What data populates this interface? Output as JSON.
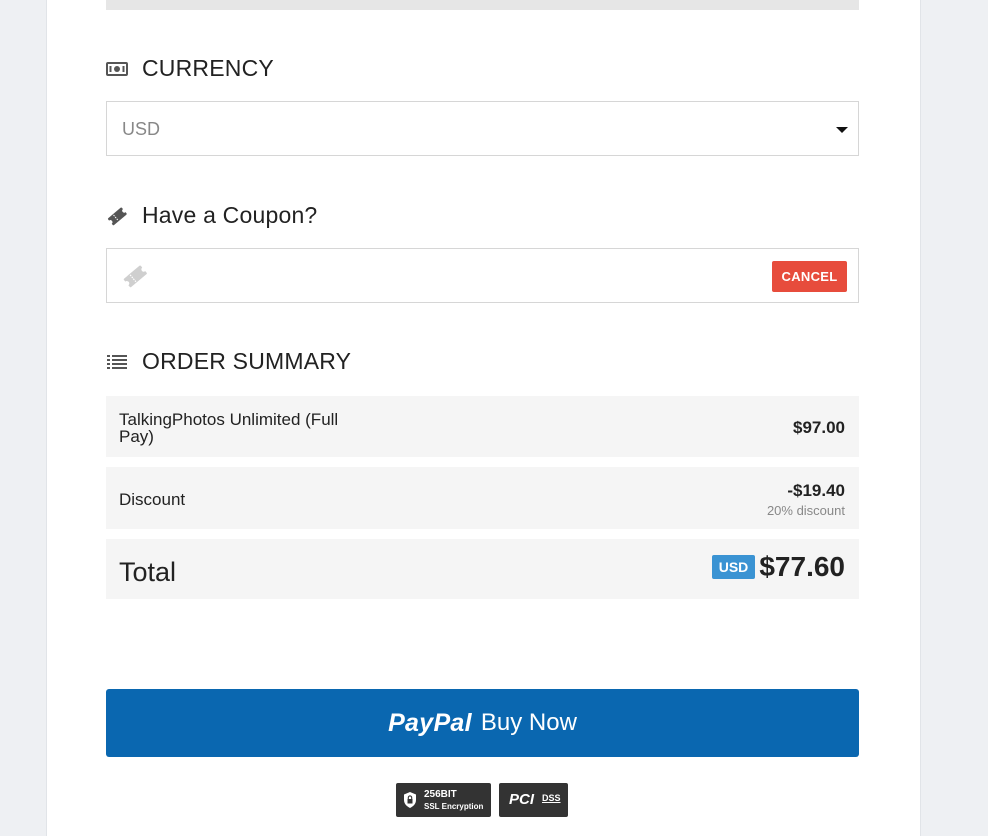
{
  "currency": {
    "heading": "CURRENCY",
    "icon": "money-icon",
    "selected": "USD"
  },
  "coupon": {
    "heading": "Have a Coupon?",
    "icon": "ticket-icon",
    "input_value": "",
    "cancel_label": "CANCEL",
    "cancel_color": "#e74c3c"
  },
  "order_summary": {
    "heading": "ORDER SUMMARY",
    "icon": "list-icon",
    "items": [
      {
        "name": "TalkingPhotos Unlimited (Full Pay)",
        "amount": "$97.00"
      },
      {
        "name": "Discount",
        "amount": "-$19.40",
        "note": "20% discount"
      }
    ],
    "total": {
      "label": "Total",
      "currency_badge": "USD",
      "amount": "$77.60"
    }
  },
  "checkout": {
    "paypal_logo": "PayPal",
    "button_text": "Buy Now",
    "button_color": "#0a67b0"
  },
  "security_badges": {
    "ssl_line1": "256BIT",
    "ssl_line2": "SSL Encryption",
    "pci_line1": "PCI",
    "pci_line2": "DSS"
  }
}
